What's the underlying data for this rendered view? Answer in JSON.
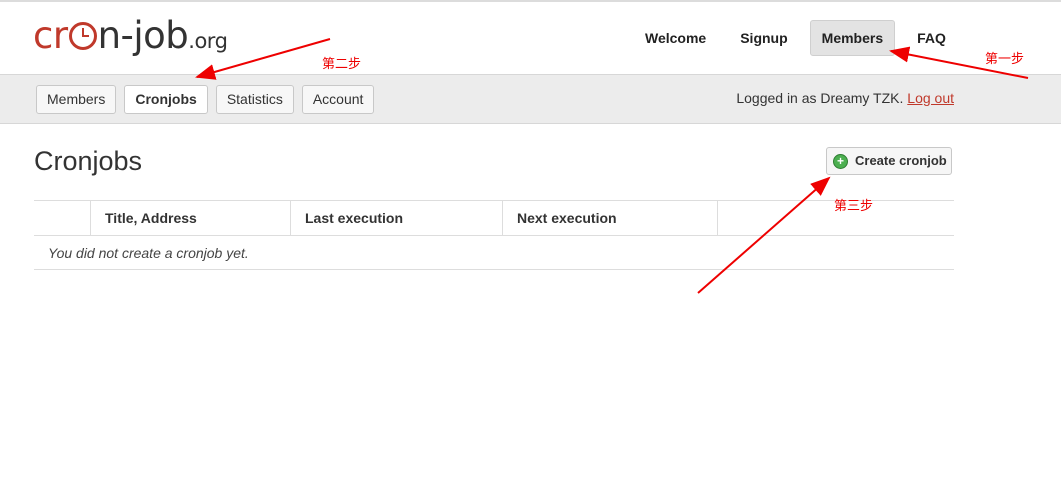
{
  "logo": {
    "part1": "cr",
    "part2": "n-job",
    "tld": ".org"
  },
  "top_nav": [
    {
      "label": "Welcome",
      "active": false
    },
    {
      "label": "Signup",
      "active": false
    },
    {
      "label": "Members",
      "active": true
    },
    {
      "label": "FAQ",
      "active": false
    }
  ],
  "sub_nav": [
    {
      "label": "Members",
      "active": false
    },
    {
      "label": "Cronjobs",
      "active": true
    },
    {
      "label": "Statistics",
      "active": false
    },
    {
      "label": "Account",
      "active": false
    }
  ],
  "login": {
    "text": "Logged in as Dreamy TZK.",
    "logout_label": "Log out"
  },
  "page": {
    "title": "Cronjobs",
    "create_label": "Create cronjob",
    "create_icon": "plus-circle-icon"
  },
  "table": {
    "headers": [
      "",
      "Title, Address",
      "Last execution",
      "Next execution",
      ""
    ],
    "empty_message": "You did not create a cronjob yet."
  },
  "annotations": {
    "step1": "第一步",
    "step2": "第二步",
    "step3": "第三步",
    "color": "#ff0000"
  }
}
